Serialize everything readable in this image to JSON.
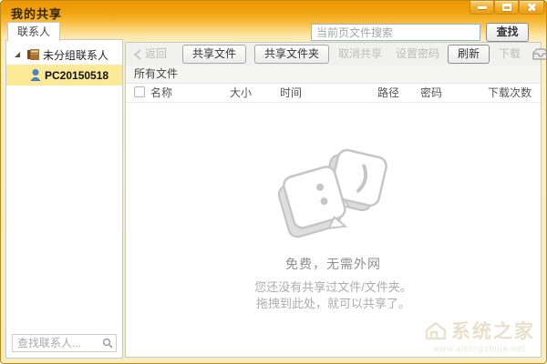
{
  "window": {
    "title": "我的共享"
  },
  "search_bar": {
    "placeholder": "当前页文件搜索",
    "find_button": "查找"
  },
  "sidebar": {
    "tab_label": "联系人",
    "tree": [
      {
        "type": "group",
        "label": "未分组联系人",
        "expanded": true
      },
      {
        "type": "contact",
        "label": "PC20150518",
        "selected": true
      }
    ],
    "search_placeholder": "查找联系人..."
  },
  "toolbar": {
    "items": [
      {
        "label": "返回",
        "enabled": false
      },
      {
        "label": "共享文件",
        "enabled": true
      },
      {
        "label": "共享文件夹",
        "enabled": true
      },
      {
        "label": "取消共享",
        "enabled": false
      },
      {
        "label": "设置密码",
        "enabled": false
      },
      {
        "label": "刷新",
        "enabled": true
      },
      {
        "label": "下载",
        "enabled": false
      }
    ]
  },
  "files": {
    "section_title": "所有文件",
    "columns": [
      "名称",
      "大小",
      "时间",
      "路径",
      "密码",
      "下载次数"
    ],
    "rows": [],
    "empty": {
      "tagline": "免费，无需外网",
      "line1": "您还没有共享过文件/文件夹。",
      "line2": "拖拽到此处，就可以共享了。"
    }
  },
  "watermark": {
    "brand": "系统之家",
    "site": "www.xitongzhijia.net"
  },
  "icons": {
    "window": [
      "minimize-icon",
      "maximize-icon",
      "close-icon"
    ],
    "back_chevron": "chevron-left-icon",
    "tray": "drawer-icon",
    "tree_expander": "expander-icon",
    "group": "address-book-icon",
    "contact": "person-icon",
    "search": "magnifier-icon",
    "checkbox": "checkbox"
  },
  "colors": {
    "titlebar_top": "#ed9505",
    "titlebar_bottom": "#f8edc0",
    "selection": "#fdea96",
    "toolbar_bg": "#f1f1ee",
    "disabled_text": "#bdbdbd",
    "panel_border": "#c9c9c3"
  }
}
